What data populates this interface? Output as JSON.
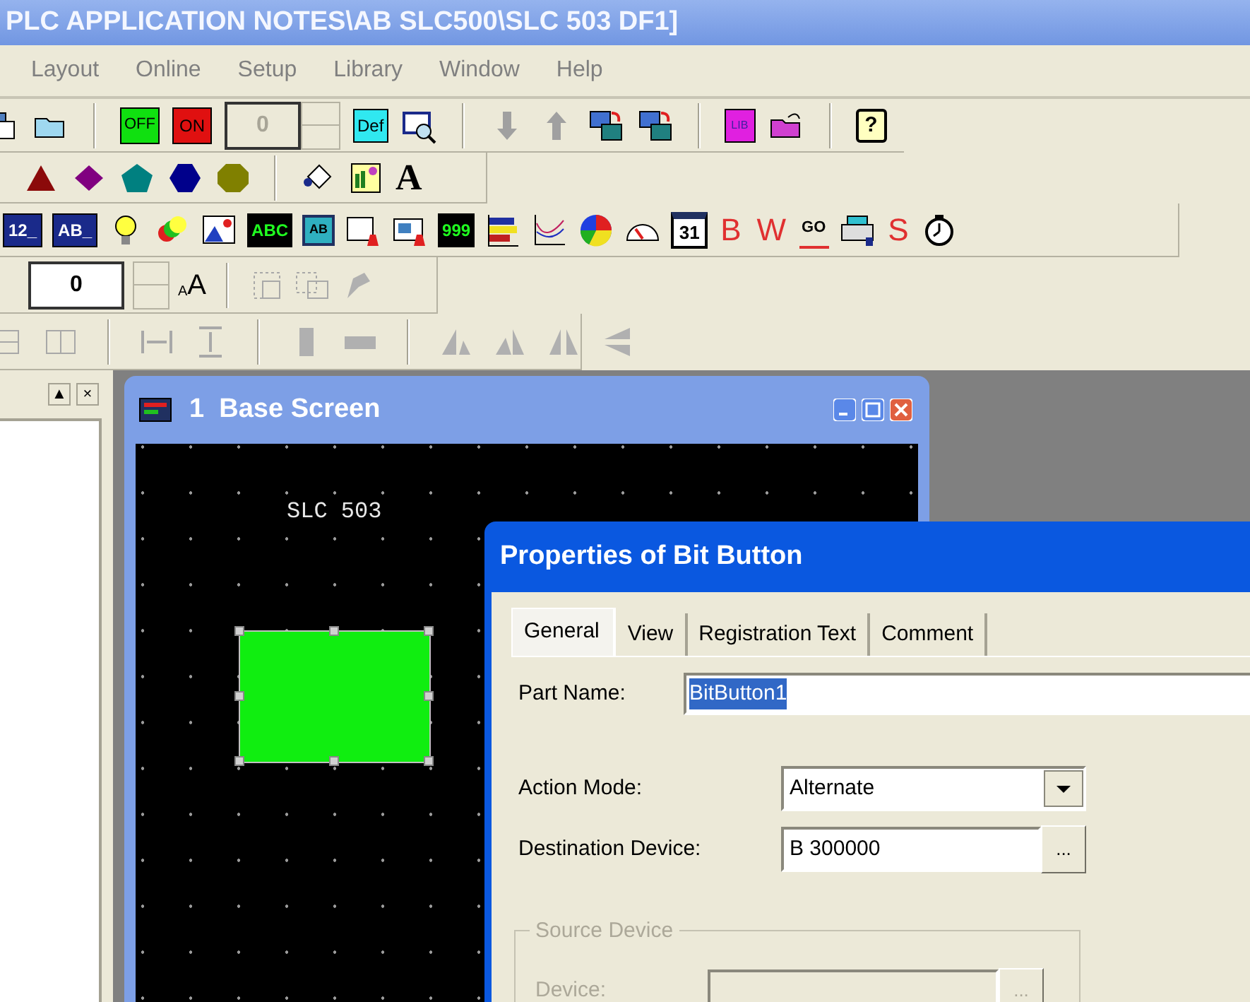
{
  "window": {
    "title": "PLC APPLICATION NOTES\\AB SLC500\\SLC 503 DF1]"
  },
  "menu": [
    {
      "label": "Layout"
    },
    {
      "label": "Online"
    },
    {
      "label": "Setup"
    },
    {
      "label": "Library"
    },
    {
      "label": "Window"
    },
    {
      "label": "Help"
    }
  ],
  "toolbar_standard": {
    "off_button": "OFF",
    "on_button": "ON",
    "state_field": {
      "value": "0",
      "disabled": true
    },
    "def_button": "Def",
    "library_button": "LIB",
    "help_button": "?"
  },
  "toolbar_draw": {
    "text_tool": "A"
  },
  "toolbar_parts": [
    {
      "kind": "blue-text",
      "text": "12_"
    },
    {
      "kind": "blue-text",
      "text": "AB_"
    },
    {
      "kind": "bulb"
    },
    {
      "kind": "lamps"
    },
    {
      "kind": "picture"
    },
    {
      "kind": "green-text",
      "text": "ABC"
    },
    {
      "kind": "window-text",
      "text": "AB"
    },
    {
      "kind": "alarm-list"
    },
    {
      "kind": "alarm-picture"
    },
    {
      "kind": "green-text",
      "text": "999"
    },
    {
      "kind": "bars"
    },
    {
      "kind": "trend"
    },
    {
      "kind": "pie"
    },
    {
      "kind": "meter"
    },
    {
      "kind": "calendar",
      "text": "31"
    },
    {
      "kind": "red-letter",
      "text": "B"
    },
    {
      "kind": "red-letter",
      "text": "W"
    },
    {
      "kind": "go-text",
      "text": "GO"
    },
    {
      "kind": "printer"
    },
    {
      "kind": "red-letter",
      "text": "S"
    },
    {
      "kind": "stopwatch"
    }
  ],
  "toolbar_font": {
    "size_field": {
      "value": "0"
    },
    "font_size_button": [
      "A",
      "A"
    ]
  },
  "left_panel": {
    "buttons": [
      "▲",
      "×"
    ]
  },
  "base_screen": {
    "title": "1  Base Screen",
    "canvas_label": "SLC 503",
    "bit_button": {
      "selected": true
    }
  },
  "dialog": {
    "title": "Properties of Bit Button",
    "tabs": [
      {
        "label": "General",
        "selected": true
      },
      {
        "label": "View",
        "selected": false
      },
      {
        "label": "Registration Text",
        "selected": false
      },
      {
        "label": "Comment",
        "selected": false
      }
    ],
    "part_name": {
      "label": "Part Name:",
      "value": "BitButton1",
      "text_selected": true
    },
    "action_mode": {
      "label": "Action Mode:",
      "value": "Alternate"
    },
    "destination_device": {
      "label": "Destination Device:",
      "value": "B 300000",
      "browse": "..."
    },
    "source_device": {
      "legend": "Source Device",
      "disabled": true,
      "label": "Device:",
      "browse": "..."
    }
  }
}
